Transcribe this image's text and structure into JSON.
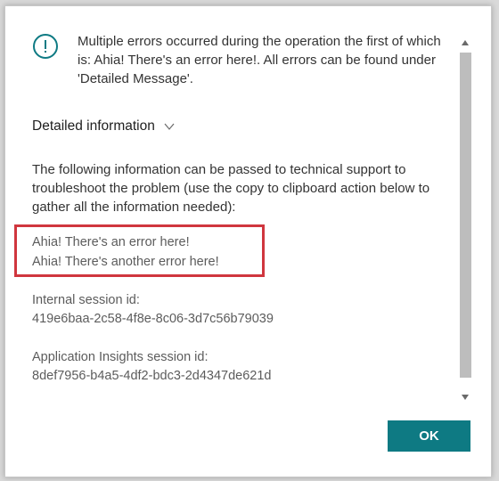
{
  "dialog": {
    "message_lines": [
      "Multiple errors occurred during the operation the first of which",
      "is: Ahia! There's an error here!. All errors can be found under",
      "'Detailed Message'."
    ],
    "detail_header": "Detailed information",
    "support_lines": [
      "The following information can be passed to technical support to",
      "troubleshoot the problem (use the copy to clipboard action below to",
      "gather all the information needed):"
    ],
    "errors": [
      "Ahia! There's an error here!",
      "Ahia! There's another error here!"
    ],
    "internal_session_label": "Internal session id:",
    "internal_session_id": "419e6baa-2c58-4f8e-8c06-3d7c56b79039",
    "insights_session_label": "Application Insights session id:",
    "insights_session_id": "8def7956-b4a5-4df2-bdc3-2d4347de621d",
    "ok_label": "OK"
  },
  "colors": {
    "accent": "#0e7a83",
    "highlight_border": "#d0363e"
  },
  "icons": {
    "alert": "exclamation-circle-icon",
    "expand": "chevron-down-icon",
    "scroll_up": "scroll-up-arrow-icon",
    "scroll_down": "scroll-down-arrow-icon"
  }
}
